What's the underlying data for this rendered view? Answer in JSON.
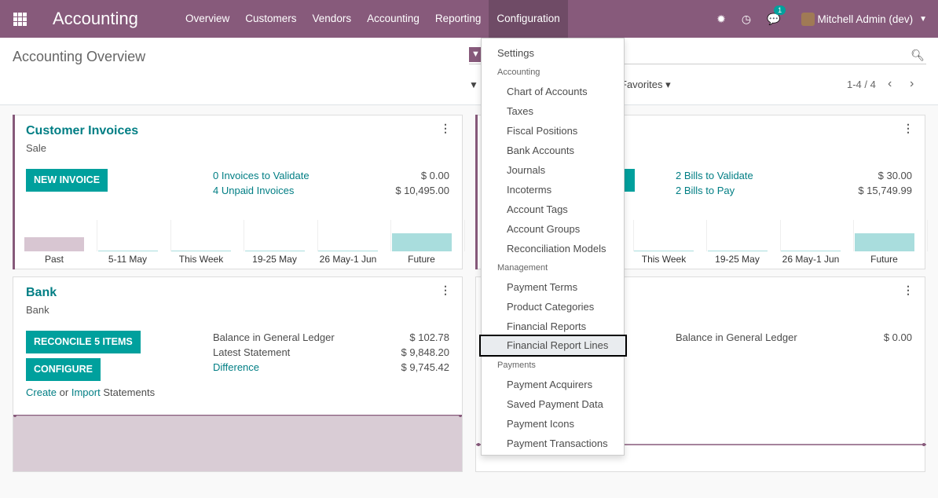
{
  "navbar": {
    "brand": "Accounting",
    "menu": [
      "Overview",
      "Customers",
      "Vendors",
      "Accounting",
      "Reporting",
      "Configuration"
    ],
    "chat_badge": "1",
    "user": "Mitchell Admin (dev)"
  },
  "control_panel": {
    "title": "Accounting Overview",
    "favorites": "Favorites",
    "pager": "1-4 / 4"
  },
  "customer_invoices": {
    "title": "Customer Invoices",
    "subtitle": "Sale",
    "button": "NEW INVOICE",
    "stats": [
      {
        "label": "0 Invoices to Validate",
        "value": "$ 0.00"
      },
      {
        "label": "4 Unpaid Invoices",
        "value": "$ 10,495.00"
      }
    ]
  },
  "vendor_bills": {
    "stats": [
      {
        "label": "2 Bills to Validate",
        "value": "$ 30.00"
      },
      {
        "label": "2 Bills to Pay",
        "value": "$ 15,749.99"
      }
    ]
  },
  "bank": {
    "title": "Bank",
    "subtitle": "Bank",
    "reconcile_button": "RECONCILE 5 ITEMS",
    "configure_button": "CONFIGURE",
    "create_link": "Create",
    "or_text": "or",
    "import_link": "Import",
    "statements_text": "Statements",
    "stats": [
      {
        "label": "Balance in General Ledger",
        "value": "$ 102.78"
      },
      {
        "label": "Latest Statement",
        "value": "$ 9,848.20"
      },
      {
        "label": "Difference",
        "value": "$ 9,745.42"
      }
    ]
  },
  "cash": {
    "stats": [
      {
        "label": "Balance in General Ledger",
        "value": "$ 0.00"
      }
    ]
  },
  "chart_data": [
    {
      "type": "bar",
      "categories": [
        "Past",
        "5-11 May",
        "This Week",
        "19-25 May",
        "26 May-1 Jun",
        "Future"
      ],
      "values": [
        0.45,
        0.02,
        0.02,
        0.02,
        0.02,
        0.58
      ],
      "colors": [
        "#d8c6d2",
        "#a9dddd",
        "#a9dddd",
        "#a9dddd",
        "#a9dddd",
        "#a9dddd"
      ]
    },
    {
      "type": "bar",
      "categories": [
        "Past",
        "5-11 May",
        "This Week",
        "19-25 May",
        "26 May-1 Jun",
        "Future"
      ],
      "values": [
        0.0,
        0.02,
        0.02,
        0.02,
        0.02,
        0.58
      ],
      "colors": [
        "#a9dddd",
        "#a9dddd",
        "#a9dddd",
        "#a9dddd",
        "#a9dddd",
        "#a9dddd"
      ]
    }
  ],
  "config_menu": {
    "items": [
      {
        "type": "item",
        "label": "Settings",
        "top": true
      },
      {
        "type": "header",
        "label": "Accounting"
      },
      {
        "type": "item",
        "label": "Chart of Accounts"
      },
      {
        "type": "item",
        "label": "Taxes"
      },
      {
        "type": "item",
        "label": "Fiscal Positions"
      },
      {
        "type": "item",
        "label": "Bank Accounts"
      },
      {
        "type": "item",
        "label": "Journals"
      },
      {
        "type": "item",
        "label": "Incoterms"
      },
      {
        "type": "item",
        "label": "Account Tags"
      },
      {
        "type": "item",
        "label": "Account Groups"
      },
      {
        "type": "item",
        "label": "Reconciliation Models"
      },
      {
        "type": "header",
        "label": "Management"
      },
      {
        "type": "item",
        "label": "Payment Terms"
      },
      {
        "type": "item",
        "label": "Product Categories"
      },
      {
        "type": "item",
        "label": "Financial Reports"
      },
      {
        "type": "item",
        "label": "Financial Report Lines",
        "selected": true
      },
      {
        "type": "header",
        "label": "Payments"
      },
      {
        "type": "item",
        "label": "Payment Acquirers"
      },
      {
        "type": "item",
        "label": "Saved Payment Data"
      },
      {
        "type": "item",
        "label": "Payment Icons"
      },
      {
        "type": "item",
        "label": "Payment Transactions"
      }
    ]
  }
}
